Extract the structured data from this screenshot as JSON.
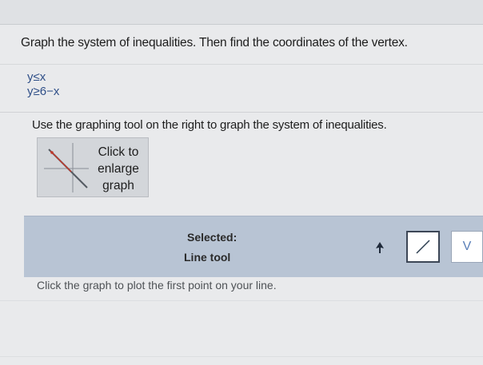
{
  "problem": {
    "statement": "Graph the system of inequalities. Then find the coordinates of the vertex.",
    "inequalities": [
      "y≤x",
      "y≥6−x"
    ]
  },
  "instruction": "Use the graphing tool on the right to graph the system of inequalities.",
  "thumbnail": {
    "label_line1": "Click to",
    "label_line2": "enlarge",
    "label_line3": "graph",
    "icon": "graph-thumbnail-icon"
  },
  "toolbar": {
    "selected_label": "Selected:",
    "selected_tool": "Line tool",
    "tools": [
      {
        "name": "select-arrow-icon"
      },
      {
        "name": "line-tool-icon"
      },
      {
        "name": "more-tools-chevron-icon",
        "glyph": "V"
      }
    ],
    "accent_color": "#b8c4d4"
  },
  "status_text": "Click the graph to plot the first point on your line."
}
